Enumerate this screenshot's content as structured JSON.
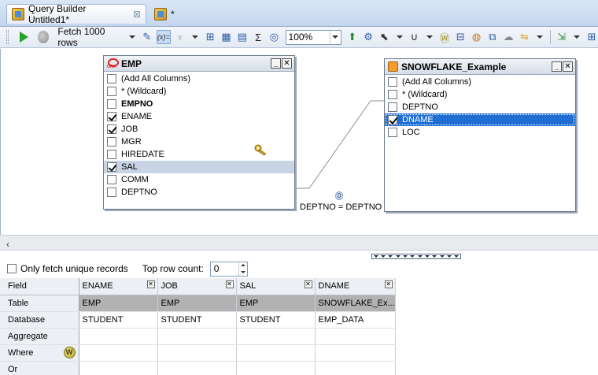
{
  "tabs": [
    {
      "label": "Query Builder Untitled1*",
      "active": true
    },
    {
      "label": "*",
      "active": false
    }
  ],
  "toolbar": {
    "fetch_label": "Fetch 1000 rows",
    "zoom_value": "100%",
    "function_icon_label": "(x)="
  },
  "tables": {
    "emp": {
      "title": "EMP",
      "columns": [
        {
          "label": "(Add All Columns)",
          "checked": false,
          "bold": false
        },
        {
          "label": "* (Wildcard)",
          "checked": false,
          "bold": false
        },
        {
          "label": "EMPNO",
          "checked": false,
          "bold": true
        },
        {
          "label": "ENAME",
          "checked": true,
          "bold": false
        },
        {
          "label": "JOB",
          "checked": true,
          "bold": false
        },
        {
          "label": "MGR",
          "checked": false,
          "bold": false
        },
        {
          "label": "HIREDATE",
          "checked": false,
          "bold": false
        },
        {
          "label": "SAL",
          "checked": true,
          "bold": false
        },
        {
          "label": "COMM",
          "checked": false,
          "bold": false
        },
        {
          "label": "DEPTNO",
          "checked": false,
          "bold": false
        }
      ]
    },
    "snowflake": {
      "title": "SNOWFLAKE_Example",
      "columns": [
        {
          "label": "(Add All Columns)",
          "checked": false
        },
        {
          "label": "* (Wildcard)",
          "checked": false
        },
        {
          "label": "DEPTNO",
          "checked": false
        },
        {
          "label": "DNAME",
          "checked": true
        },
        {
          "label": "LOC",
          "checked": false
        }
      ]
    }
  },
  "join": {
    "label": "DEPTNO = DEPTNO",
    "node_label": "0"
  },
  "options": {
    "unique_label": "Only fetch unique records",
    "unique_checked": false,
    "top_row_label": "Top row count:",
    "top_row_value": "0"
  },
  "grid": {
    "row_headers": [
      "Field",
      "Table",
      "Database",
      "Aggregate",
      "Where",
      "Or"
    ],
    "columns": [
      {
        "field": "ENAME",
        "table": "EMP",
        "database": "STUDENT"
      },
      {
        "field": "JOB",
        "table": "EMP",
        "database": "STUDENT"
      },
      {
        "field": "SAL",
        "table": "EMP",
        "database": "STUDENT"
      },
      {
        "field": "DNAME",
        "table": "SNOWFLAKE_Ex...",
        "database": "EMP_DATA"
      }
    ]
  },
  "colors": {
    "selection_blue": "#1f6ed4",
    "selection_grey": "#c8d4e3",
    "table_row_fill": "#b2b2b2"
  }
}
